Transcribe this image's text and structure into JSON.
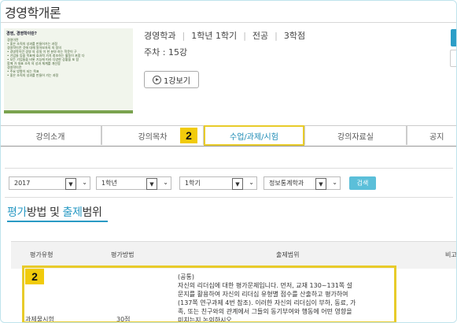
{
  "course": {
    "title": "경영학개론",
    "department": "경영학과",
    "grade_term": "1학년 1학기",
    "category": "전공",
    "credits": "3학점",
    "week_prefix": "주차 : ",
    "week_value": "15강",
    "watch_label": "1강보기"
  },
  "thumbnail": {
    "heading": "경영, 경영학이란?",
    "lines": [
      "경영이란",
      "• 좋은 조직의 성과를 만들어가는 과정",
      "경영학이란 것에 대해 알아보자의 의 정의",
      "• 경영학이란 경영 의 성질 이 한 분야 하는 학문이 구",
      "• 기업들 등을 목표에 효과적 가치 창조하는 활동이 포함 다",
      "• 모든 기업들을 비롯 기능에 따라 다양한 상황을 포 함",
      "함께 가 대표 조직 의 성과 체계를 개선함",
      "경영학이란",
      "• 주요 방향이 되는 목표",
      "• 좋은 조직의 성과를 만들어 가는 과정"
    ]
  },
  "tabs": [
    "강의소개",
    "강의목차",
    "수업/과제/시험",
    "강의자료실",
    "공지"
  ],
  "active_tab_index": 2,
  "badges": {
    "tab_badge": "2",
    "table_badge": "2"
  },
  "filters": {
    "year": "2017",
    "grade": "1학년",
    "term": "1학기",
    "dept": "정보통계학과",
    "search_label": "검색",
    "dropdown_glyph": "▼",
    "chevron_glyph": "⌄"
  },
  "section": {
    "part1": "평가",
    "part2": "방법 및 ",
    "part3": "출제",
    "part4": "범위"
  },
  "table": {
    "headers": [
      "평가유형",
      "평가방법",
      "출제범위",
      "비고"
    ],
    "row": {
      "type": "과제물시험",
      "method": "30점",
      "scope_lines": [
        "(공통)",
        "자신의 리더십에 대한 평가문제입니다. 먼저, 교재 130~131쪽 설",
        "문지를 활용하여 자신의 리더십 유형별 점수를 산출하고 평가하여",
        "(137쪽 연구과제 4번 참조). 이러한 자신의 리더십이 부하, 동료, 가",
        "족, 또는 친구와의 관계에서 그들의 동기부여와 행동에 어떤 영향을",
        "미치는지 논의하시오"
      ]
    }
  },
  "colors": {
    "accent": "#2a9ac4",
    "highlight": "#e8cb2a",
    "badge": "#f1cb0c",
    "search_btn": "#5bbfd9"
  }
}
